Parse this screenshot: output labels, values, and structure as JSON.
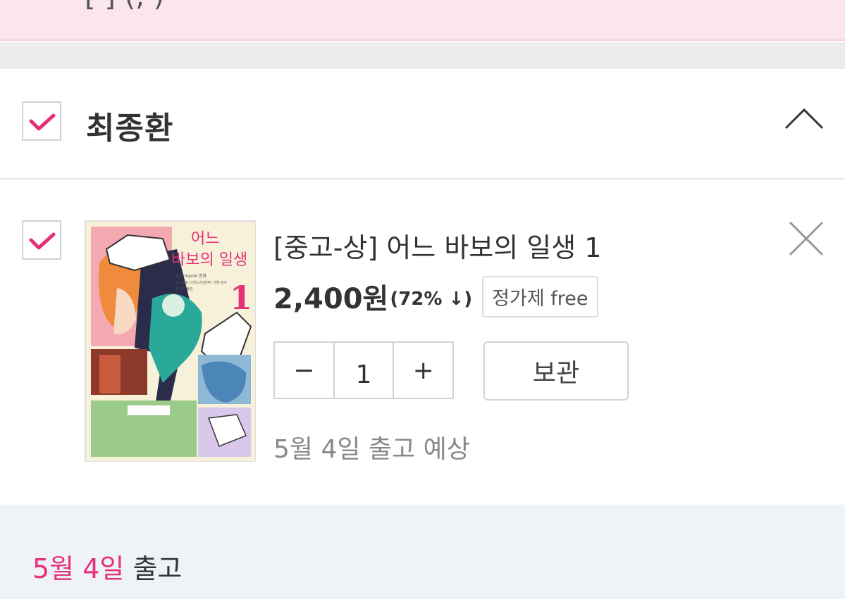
{
  "banner": {
    "text": "[  ] (, ) "
  },
  "seller": {
    "name": "최종환",
    "checked": true
  },
  "item": {
    "checked": true,
    "title": "[중고-상] 어느 바보의 일생 1",
    "price": "2,400원",
    "discount": "(72% ↓)",
    "badge": "정가제 free",
    "quantity": "1",
    "minus_label": "−",
    "plus_label": "+",
    "save_label": "보관",
    "ship_estimate": "5월 4일 출고 예상",
    "cover": {
      "title_line1": "어느",
      "title_line2": "바보의 일생",
      "volume": "1",
      "author": "Totempole 만화",
      "credits": "와시토토 다카노리(원작) 기획 감수",
      "translator": "김민아 옮김"
    }
  },
  "shipping": {
    "date": "5월 4일",
    "suffix": " 출고"
  },
  "colors": {
    "accent": "#e5307a",
    "banner_bg": "#fce6ed",
    "footer_bg": "#eff3f8"
  }
}
